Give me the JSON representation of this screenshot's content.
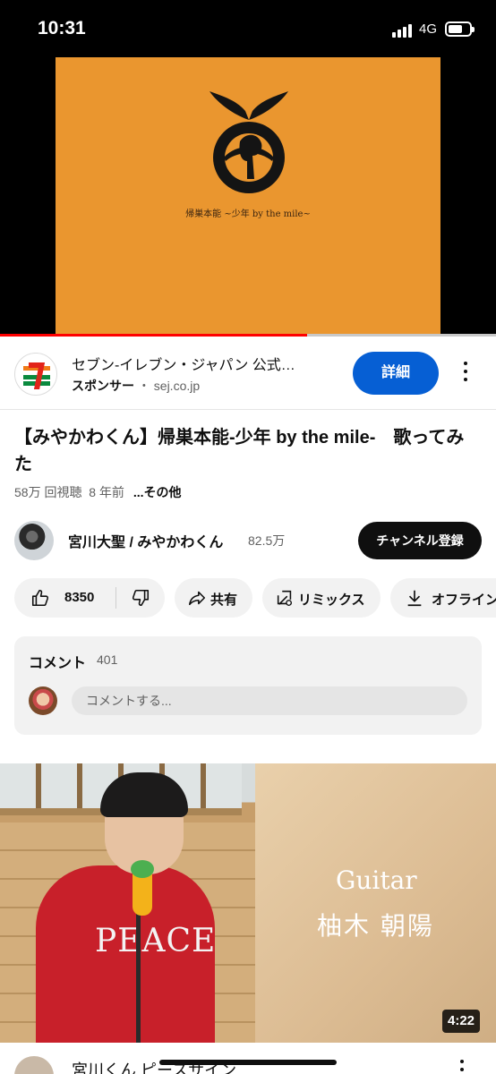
{
  "status_bar": {
    "time": "10:31",
    "network": "4G",
    "battery_level": 0.7,
    "signal_bars": 4
  },
  "player": {
    "overlay_caption": "帰巣本能 ~少年 by the mile~",
    "progress": 0.62,
    "accent_color": "#ff0000",
    "background_color": "#ea962f"
  },
  "sponsor": {
    "title": "セブン-イレブン・ジャパン 公式…",
    "sponsor_label": "スポンサー",
    "separator": "・",
    "domain": "sej.co.jp",
    "cta_label": "詳細",
    "cta_color": "#065fd4",
    "logo_icon": "seven-eleven-logo"
  },
  "video": {
    "title": "【みやかわくん】帰巣本能-少年 by the mile-　歌ってみた",
    "views": "58万 回視聴",
    "age": "8 年前",
    "more_label": "...その他"
  },
  "channel": {
    "name": "宮川大聖 / みやかわくん",
    "subscribers": "82.5万",
    "subscribe_label": "チャンネル登録"
  },
  "actions": {
    "like_count": "8350",
    "share_label": "共有",
    "remix_label": "リミックス",
    "offline_label": "オフライン"
  },
  "comments": {
    "label": "コメント",
    "count": "401",
    "placeholder": "コメントする..."
  },
  "next_video": {
    "overlay_line1": "Guitar",
    "overlay_line2": "柚木 朝陽",
    "shirt_text": "PEACE",
    "duration": "4:22",
    "title": "宮川くん ピースサイン"
  }
}
